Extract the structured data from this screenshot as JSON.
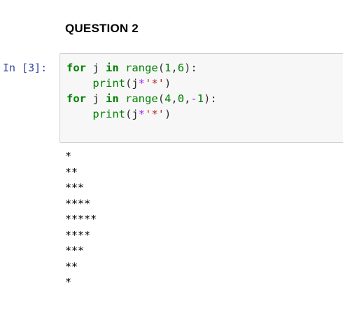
{
  "markdown": {
    "heading": "QUESTION 2"
  },
  "cell": {
    "prompt": "In [3]:",
    "code_lines": [
      [
        {
          "t": "for",
          "c": "kw"
        },
        {
          "t": " j ",
          "c": ""
        },
        {
          "t": "in",
          "c": "kw"
        },
        {
          "t": " ",
          "c": ""
        },
        {
          "t": "range",
          "c": "bi"
        },
        {
          "t": "(",
          "c": ""
        },
        {
          "t": "1",
          "c": "num"
        },
        {
          "t": ",",
          "c": ""
        },
        {
          "t": "6",
          "c": "num"
        },
        {
          "t": "):",
          "c": ""
        }
      ],
      [
        {
          "t": "    ",
          "c": ""
        },
        {
          "t": "print",
          "c": "bi"
        },
        {
          "t": "(j",
          "c": ""
        },
        {
          "t": "*",
          "c": "op"
        },
        {
          "t": "'*'",
          "c": "str"
        },
        {
          "t": ")",
          "c": ""
        }
      ],
      [
        {
          "t": "for",
          "c": "kw"
        },
        {
          "t": " j ",
          "c": ""
        },
        {
          "t": "in",
          "c": "kw"
        },
        {
          "t": " ",
          "c": ""
        },
        {
          "t": "range",
          "c": "bi"
        },
        {
          "t": "(",
          "c": ""
        },
        {
          "t": "4",
          "c": "num"
        },
        {
          "t": ",",
          "c": ""
        },
        {
          "t": "0",
          "c": "num"
        },
        {
          "t": ",",
          "c": ""
        },
        {
          "t": "-",
          "c": "op"
        },
        {
          "t": "1",
          "c": "num"
        },
        {
          "t": "):",
          "c": ""
        }
      ],
      [
        {
          "t": "    ",
          "c": ""
        },
        {
          "t": "print",
          "c": "bi"
        },
        {
          "t": "(j",
          "c": ""
        },
        {
          "t": "*",
          "c": "op"
        },
        {
          "t": "'*'",
          "c": "str"
        },
        {
          "t": ")",
          "c": ""
        }
      ]
    ],
    "output_lines": [
      "*",
      "**",
      "***",
      "****",
      "*****",
      "****",
      "***",
      "**",
      "*"
    ]
  },
  "colors": {
    "prompt": "#303f9f",
    "keyword": "#008000",
    "operator": "#aa22ff",
    "string": "#ba2121",
    "input_background": "#f7f7f7",
    "input_border": "#cfcfcf"
  }
}
